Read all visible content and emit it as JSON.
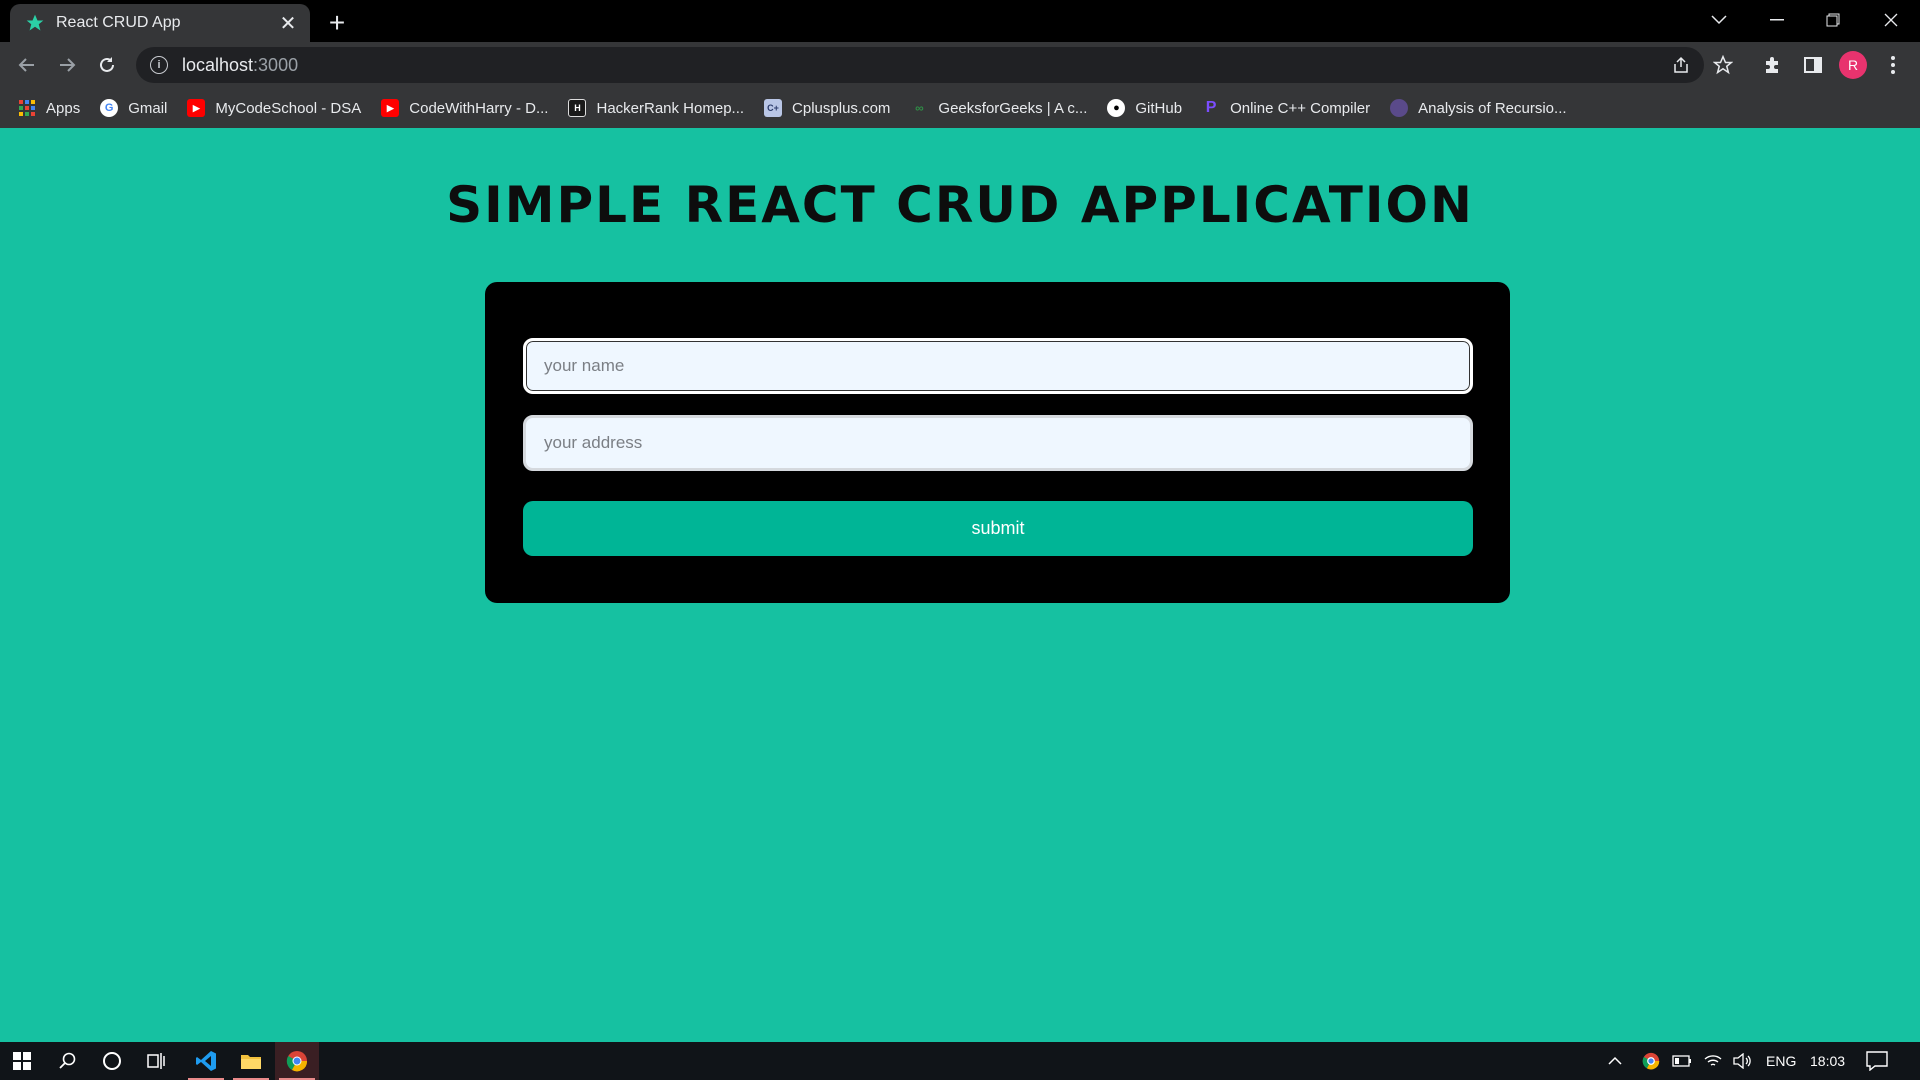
{
  "browser": {
    "tab_title": "React CRUD App",
    "url_host": "localhost",
    "url_port": ":3000",
    "profile_initial": "R"
  },
  "bookmarks": [
    {
      "label": "Apps",
      "icon": "apps-grid-icon"
    },
    {
      "label": "Gmail",
      "icon": "google-icon"
    },
    {
      "label": "MyCodeSchool - DSA",
      "icon": "youtube-icon"
    },
    {
      "label": "CodeWithHarry - D...",
      "icon": "youtube-icon"
    },
    {
      "label": "HackerRank Homep...",
      "icon": "hackerrank-icon"
    },
    {
      "label": "Cplusplus.com",
      "icon": "cplusplus-icon"
    },
    {
      "label": "GeeksforGeeks | A c...",
      "icon": "geeksforgeeks-icon"
    },
    {
      "label": "GitHub",
      "icon": "github-icon"
    },
    {
      "label": "Online C++ Compiler",
      "icon": "compiler-icon"
    },
    {
      "label": "Analysis of Recursio...",
      "icon": "globe-icon"
    }
  ],
  "page": {
    "title": "SIMPLE REACT CRUD APPLICATION",
    "name_placeholder": "your name",
    "address_placeholder": "your address",
    "submit_label": "submit"
  },
  "taskbar": {
    "language": "ENG",
    "time": "18:03"
  },
  "colors": {
    "page_background": "#16c1a1",
    "card_background": "#000000",
    "submit_button": "#00b596",
    "input_background": "#eff7ff"
  }
}
